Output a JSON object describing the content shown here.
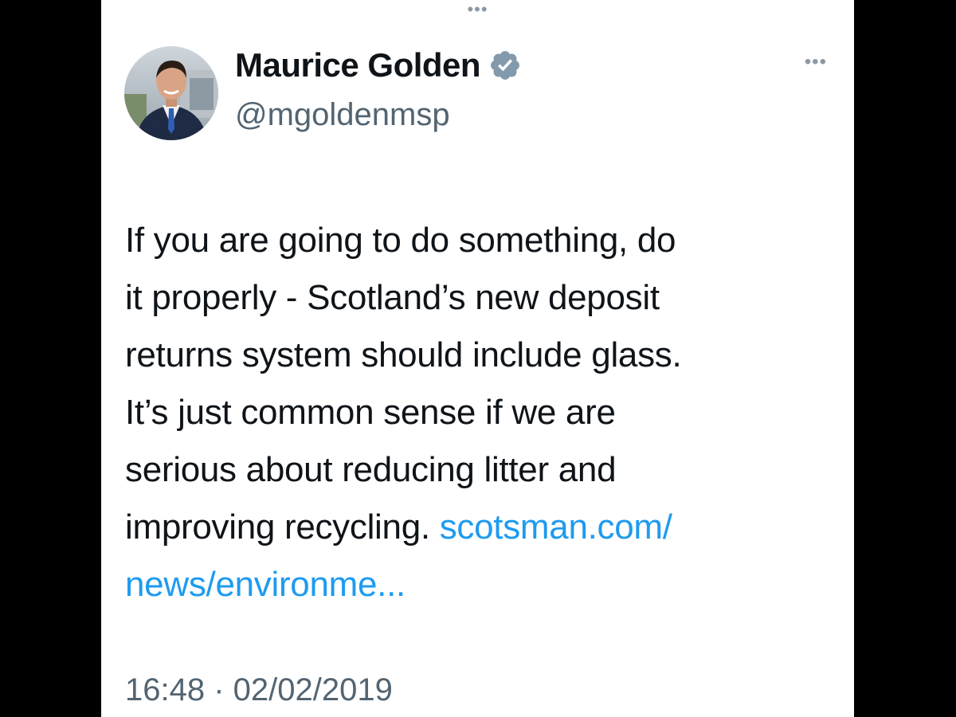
{
  "top": {
    "dots_icon": "more-dots-icon"
  },
  "author": {
    "display_name": "Maurice Golden",
    "handle": "@mgoldenmsp",
    "verified_icon": "verified-badge-icon",
    "verified_color": "#829aab"
  },
  "more_menu": {
    "icon": "more-horizontal-icon"
  },
  "tweet": {
    "lines": [
      "If you are going to do something, do",
      "it properly - Scotland’s new deposit",
      "returns system should include glass.",
      "It’s just common sense if we are",
      "serious about reducing litter and"
    ],
    "last_line_text": "improving recycling. ",
    "link_line1": "scotsman.com/",
    "link_line2": "news/environme...",
    "link_color": "#1d9bf0"
  },
  "meta": {
    "time": "16:48 · 02/02/2019"
  }
}
